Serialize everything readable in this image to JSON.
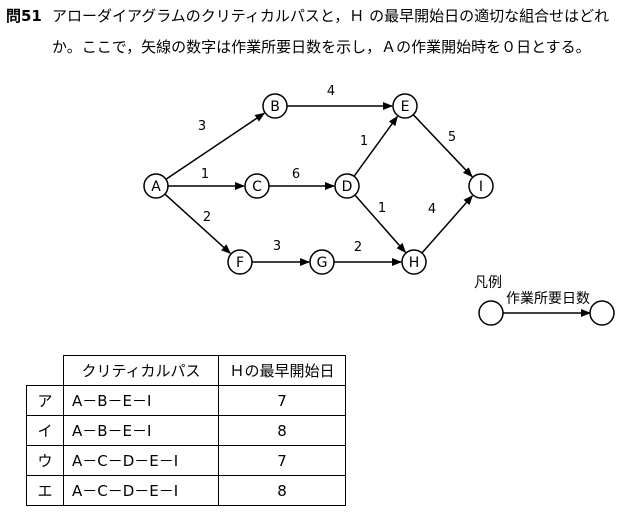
{
  "question": {
    "number": "問51",
    "line1": "アローダイアグラムのクリティカルパスと，Ｈ の最早開始日の適切な組合せはどれ",
    "line2": "か。ここで，矢線の数字は作業所要日数を示し，Ａの作業開始時を０日とする。"
  },
  "diagram": {
    "nodes": [
      {
        "id": "A",
        "label": "A"
      },
      {
        "id": "B",
        "label": "B"
      },
      {
        "id": "C",
        "label": "C"
      },
      {
        "id": "D",
        "label": "D"
      },
      {
        "id": "E",
        "label": "E"
      },
      {
        "id": "F",
        "label": "F"
      },
      {
        "id": "G",
        "label": "G"
      },
      {
        "id": "H",
        "label": "H"
      },
      {
        "id": "I",
        "label": "I"
      }
    ],
    "edges": [
      {
        "from": "A",
        "to": "B",
        "days": "3"
      },
      {
        "from": "A",
        "to": "C",
        "days": "1"
      },
      {
        "from": "A",
        "to": "F",
        "days": "2"
      },
      {
        "from": "B",
        "to": "E",
        "days": "4"
      },
      {
        "from": "C",
        "to": "D",
        "days": "6"
      },
      {
        "from": "D",
        "to": "E",
        "days": "1"
      },
      {
        "from": "D",
        "to": "H",
        "days": "1"
      },
      {
        "from": "E",
        "to": "I",
        "days": "5"
      },
      {
        "from": "F",
        "to": "G",
        "days": "3"
      },
      {
        "from": "G",
        "to": "H",
        "days": "2"
      },
      {
        "from": "H",
        "to": "I",
        "days": "4"
      }
    ]
  },
  "legend": {
    "title": "凡例",
    "edge_label": "作業所要日数"
  },
  "table": {
    "headers": {
      "path": "クリティカルパス",
      "earliest": "Ｈの最早開始日"
    },
    "rows": [
      {
        "label": "ア",
        "path": "A－B－E－I",
        "value": "7"
      },
      {
        "label": "イ",
        "path": "A－B－E－I",
        "value": "8"
      },
      {
        "label": "ウ",
        "path": "A－C－D－E－I",
        "value": "7"
      },
      {
        "label": "エ",
        "path": "A－C－D－E－I",
        "value": "8"
      }
    ]
  }
}
